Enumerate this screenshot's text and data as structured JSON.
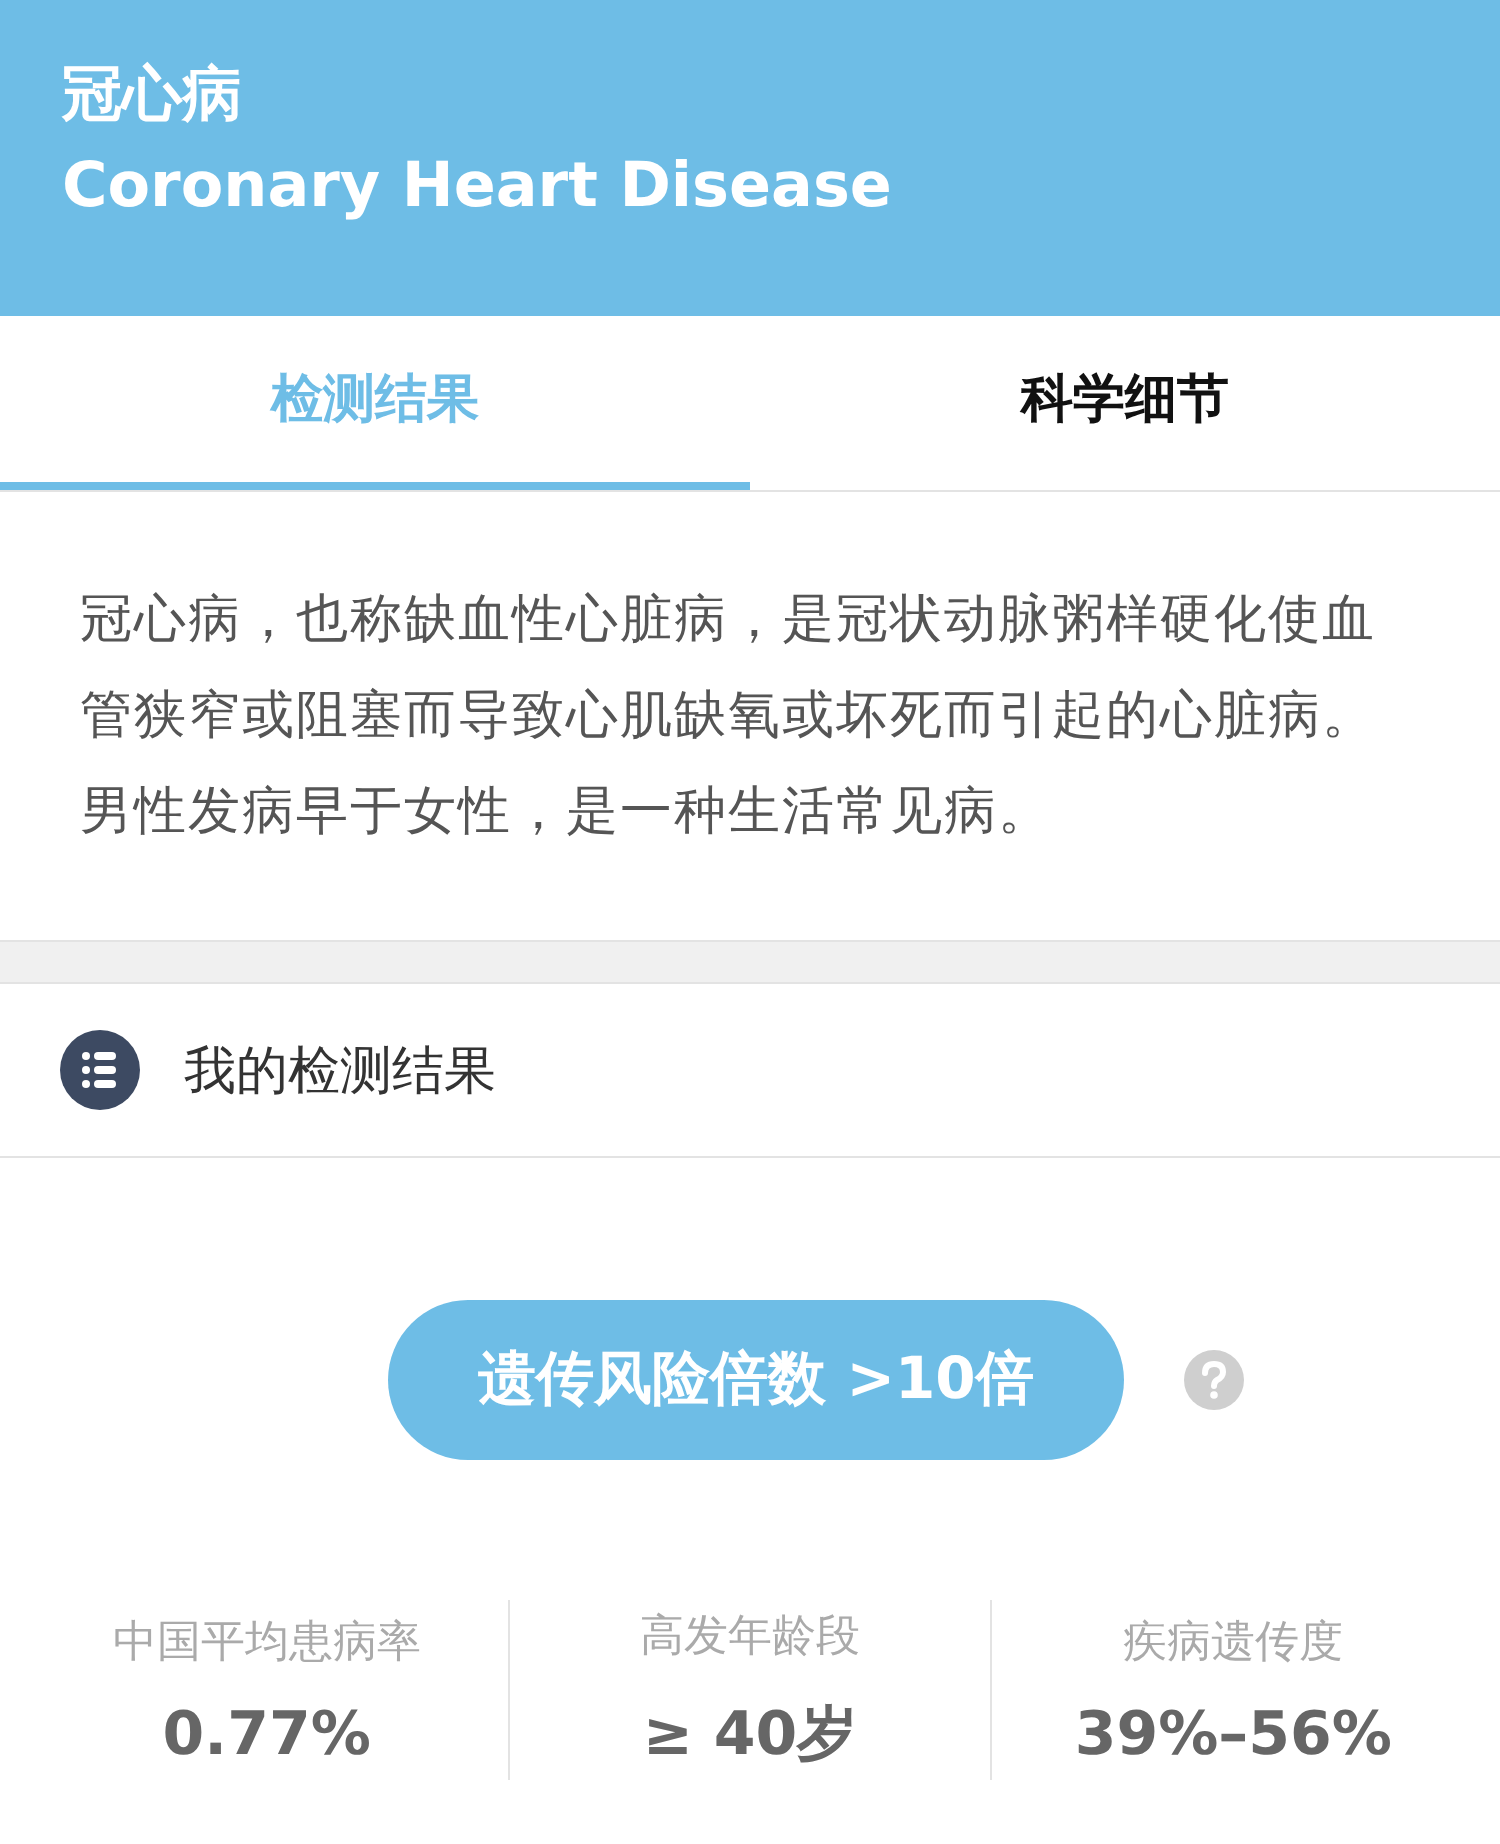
{
  "header": {
    "title": "冠心病",
    "subtitle": "Coronary Heart Disease"
  },
  "tabs": [
    {
      "label": "检测结果",
      "selected": true
    },
    {
      "label": "科学细节",
      "selected": false
    }
  ],
  "description": "冠心病，也称缺血性心脏病，是冠状动脉粥样硬化使血管狭窄或阻塞而导致心肌缺氧或坏死而引起的心脏病。男性发病早于女性，是一种生活常见病。",
  "section": {
    "title": "我的检测结果"
  },
  "risk_button": {
    "label": "遗传风险倍数 >10倍"
  },
  "stats": [
    {
      "label": "中国平均患病率",
      "value": "0.77%"
    },
    {
      "label": "高发年龄段",
      "value": "≥ 40岁"
    },
    {
      "label": "疾病遗传度",
      "value": "39%–56%"
    }
  ]
}
